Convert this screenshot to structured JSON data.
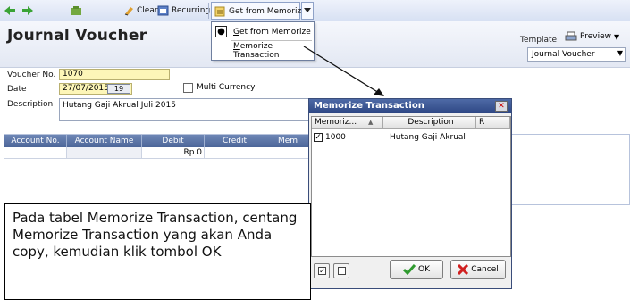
{
  "toolbar": {
    "clear_label": "Clear",
    "recurring_label": "Recurring",
    "get_from_memorize_label": "Get from Memorize"
  },
  "dropdown_menu": {
    "items": [
      "Get from Memorize",
      "Memorize Transaction"
    ]
  },
  "header": {
    "title": "Journal Voucher",
    "template_label": "Template",
    "preview_label": "Preview",
    "template_value": "Journal Voucher"
  },
  "form": {
    "voucher_no_label": "Voucher No.",
    "voucher_no_value": "1070",
    "date_label": "Date",
    "date_value": "27/07/2015",
    "calendar_label": "19",
    "multi_currency_label": "Multi Currency",
    "description_label": "Description",
    "description_value": "Hutang Gaji Akrual Juli 2015"
  },
  "grid": {
    "columns": [
      "Account No.",
      "Account Name",
      "Debit",
      "Credit",
      "Mem"
    ],
    "rows": [
      {
        "debit": "Rp 0"
      }
    ]
  },
  "dialog": {
    "title": "Memorize Transaction",
    "columns": [
      "Memoriz...",
      "Description",
      "R"
    ],
    "rows": [
      {
        "id": "1000",
        "description": "Hutang Gaji Akrual",
        "checked": true
      }
    ],
    "ok_label": "OK",
    "cancel_label": "Cancel"
  },
  "instruction": {
    "text": "Pada tabel Memorize Transaction, centang Memorize Transaction yang akan Anda copy, kemudian klik tombol OK"
  },
  "colors": {
    "toolbar_bg": "#d8e1f3",
    "grid_header": "#4d6699",
    "dialog_title": "#2e4784",
    "input_yellow": "#fdf6b8"
  }
}
